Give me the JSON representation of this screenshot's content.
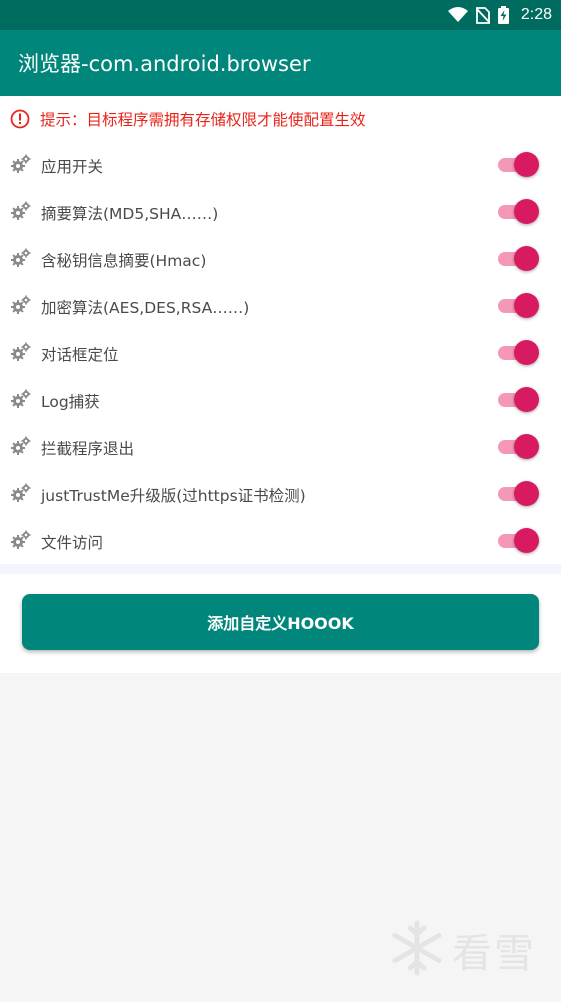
{
  "status_bar": {
    "time": "2:28",
    "icons": [
      "wifi-icon",
      "no-sim-icon",
      "battery-charging-icon"
    ]
  },
  "toolbar": {
    "title": "浏览器-com.android.browser"
  },
  "notice": {
    "icon": "warning-circle-icon",
    "text": "提示：目标程序需拥有存储权限才能使配置生效",
    "color": "#e8241a"
  },
  "settings": {
    "items": [
      {
        "label": "应用开关",
        "enabled": true
      },
      {
        "label": "摘要算法(MD5,SHA……)",
        "enabled": true
      },
      {
        "label": "含秘钥信息摘要(Hmac)",
        "enabled": true
      },
      {
        "label": "加密算法(AES,DES,RSA……)",
        "enabled": true
      },
      {
        "label": "对话框定位",
        "enabled": true
      },
      {
        "label": "Log捕获",
        "enabled": true
      },
      {
        "label": "拦截程序退出",
        "enabled": true
      },
      {
        "label": "justTrustMe升级版(过https证书检测)",
        "enabled": true
      },
      {
        "label": "文件访问",
        "enabled": true
      }
    ],
    "item_icon": "gears-icon"
  },
  "actions": {
    "add_hook_label": "添加自定义HOOOK"
  },
  "watermark": {
    "text": "看雪",
    "icon": "snowflake-icon"
  },
  "colors": {
    "status_bar": "#006b5f",
    "toolbar": "#00867a",
    "switch_thumb": "#d81b60",
    "switch_track": "#f598b6",
    "button": "#00867a"
  }
}
